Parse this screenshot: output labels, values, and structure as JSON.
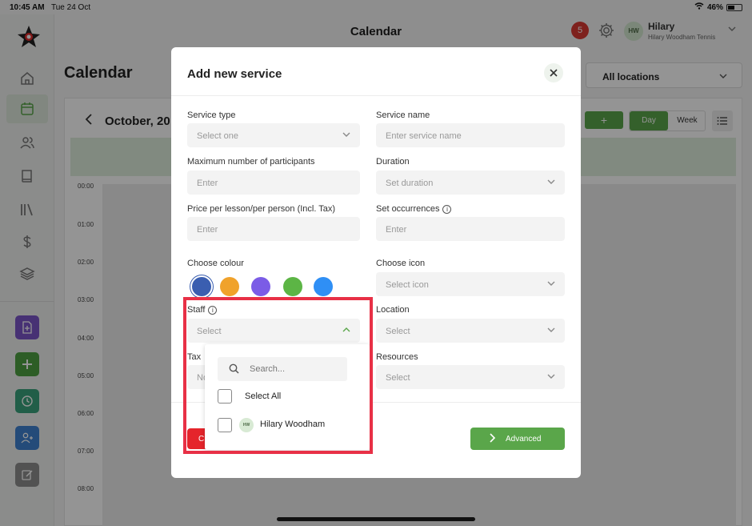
{
  "status_bar": {
    "time": "10:45 AM",
    "date": "Tue 24 Oct",
    "battery": "46%"
  },
  "header": {
    "title": "Calendar",
    "notification_count": "5",
    "user": {
      "initials": "HW",
      "name": "Hilary",
      "org": "Hilary Woodham Tennis"
    }
  },
  "sidebar": {
    "nav": [
      {
        "icon": "home-icon"
      },
      {
        "icon": "calendar-icon",
        "active": true
      },
      {
        "icon": "users-icon"
      },
      {
        "icon": "book-icon"
      },
      {
        "icon": "library-icon"
      },
      {
        "icon": "dollar-icon"
      },
      {
        "icon": "layers-icon"
      }
    ],
    "quick_actions": [
      {
        "icon": "add-document-icon",
        "color": "#7b55c9"
      },
      {
        "icon": "plus-icon",
        "color": "#4fa043"
      },
      {
        "icon": "clock-icon",
        "color": "#3aa37c"
      },
      {
        "icon": "add-user-icon",
        "color": "#3f82d0"
      },
      {
        "icon": "edit-icon",
        "color": "#8d8d8d"
      }
    ]
  },
  "calendar": {
    "title": "Calendar",
    "location_filter": "All locations",
    "month_label": "October, 20",
    "add_label": "+",
    "view_day": "Day",
    "view_week": "Week",
    "hours": [
      "00:00",
      "01:00",
      "02:00",
      "03:00",
      "04:00",
      "05:00",
      "06:00",
      "07:00",
      "08:00"
    ]
  },
  "modal": {
    "title": "Add new service",
    "service_type": {
      "label": "Service type",
      "placeholder": "Select one"
    },
    "service_name": {
      "label": "Service name",
      "placeholder": "Enter service name"
    },
    "max_participants": {
      "label": "Maximum number of participants",
      "placeholder": "Enter"
    },
    "duration": {
      "label": "Duration",
      "placeholder": "Set duration"
    },
    "price": {
      "label": "Price per lesson/per person (Incl. Tax)",
      "placeholder": "Enter"
    },
    "occurrences": {
      "label": "Set occurrences",
      "placeholder": "Enter"
    },
    "colour": {
      "label": "Choose colour",
      "options": [
        "#3a5eb0",
        "#f0a22b",
        "#7b5ce6",
        "#5cb545",
        "#2f8ff5"
      ],
      "selected_index": 0
    },
    "icon": {
      "label": "Choose icon",
      "placeholder": "Select icon"
    },
    "staff": {
      "label": "Staff",
      "placeholder": "Select"
    },
    "location": {
      "label": "Location",
      "placeholder": "Select"
    },
    "tax": {
      "label": "Tax",
      "placeholder": "No"
    },
    "resources": {
      "label": "Resources",
      "placeholder": "Select"
    },
    "cancel_label": "C",
    "advanced_label": "Advanced"
  },
  "staff_dropdown": {
    "search_placeholder": "Search...",
    "select_all": "Select All",
    "options": [
      {
        "initials": "HW",
        "name": "Hilary Woodham"
      }
    ]
  },
  "colors": {
    "accent": "#5aa64a",
    "highlight": "#e83046",
    "danger": "#e5242b"
  }
}
